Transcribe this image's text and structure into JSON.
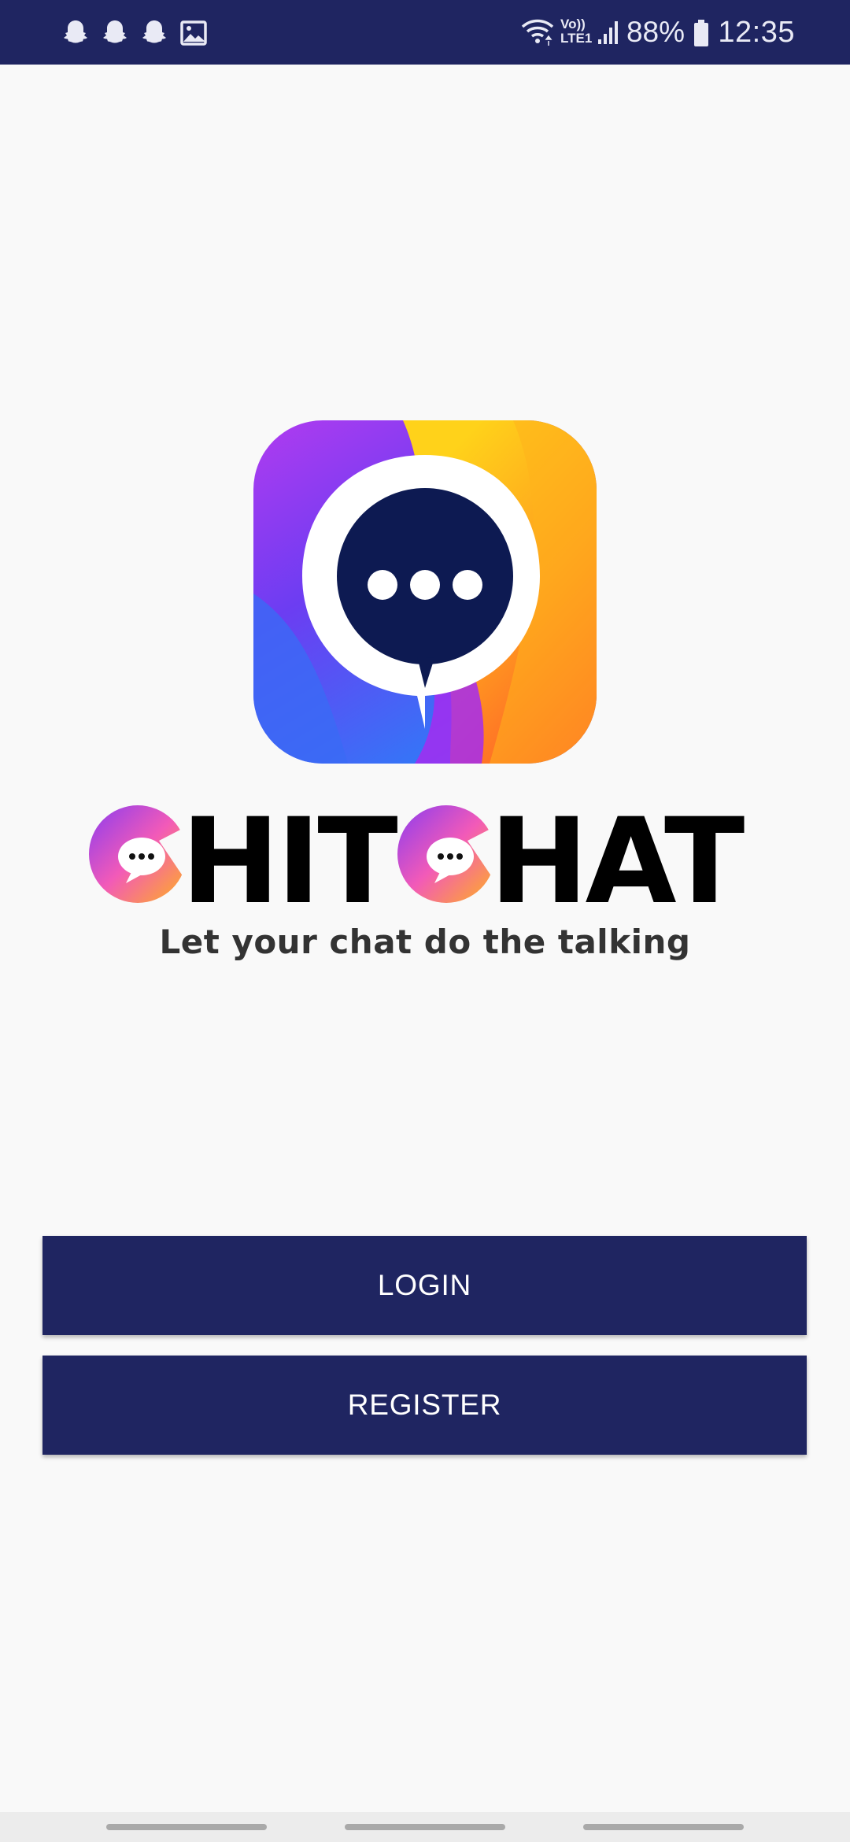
{
  "status_bar": {
    "time": "12:35",
    "battery_percent": "88%",
    "left_icons": [
      "snapchat-icon",
      "snapchat-icon",
      "snapchat-icon",
      "image-icon"
    ],
    "right_icons": [
      "wifi-icon",
      "volte-icon",
      "signal-icon",
      "battery-icon"
    ],
    "volte_label": "Vo))",
    "lte_label": "LTE1",
    "background": "#1f2561"
  },
  "logo": {
    "app_icon": "chat-bubble-logo-icon",
    "wordmark": "CHITCHAT",
    "tagline": "Let your chat do the talking"
  },
  "actions": {
    "login_label": "LOGIN",
    "register_label": "REGISTER",
    "button_color": "#1f2561"
  },
  "nav_bar": {
    "items": [
      "recent-apps-pill",
      "home-pill",
      "back-pill"
    ]
  }
}
